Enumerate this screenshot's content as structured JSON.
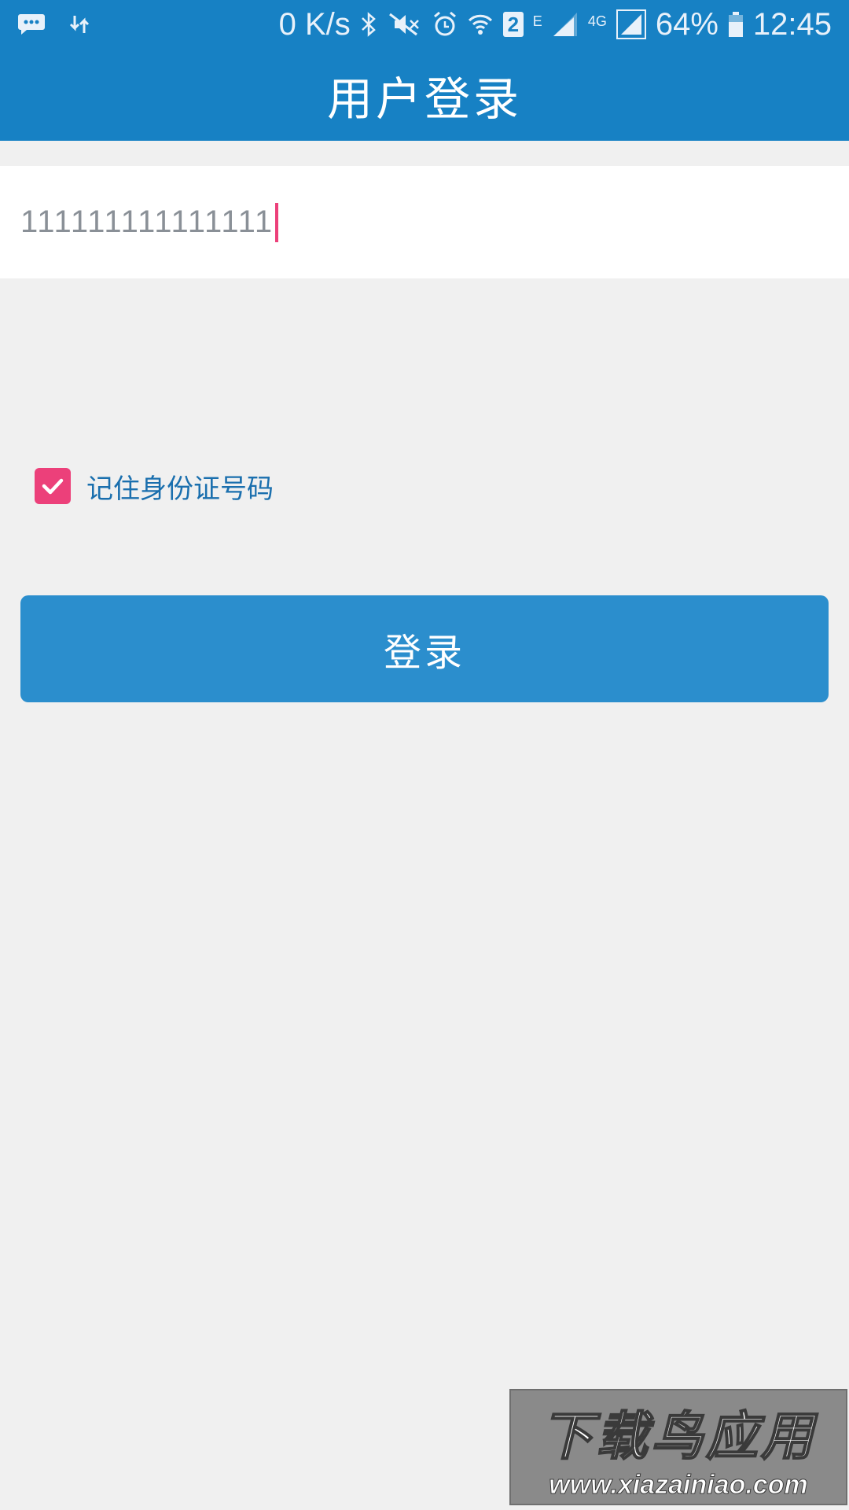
{
  "status_bar": {
    "net_speed": "0 K/s",
    "sim_badge": "2",
    "network_e": "E",
    "network_4g": "4G",
    "battery": "64%",
    "time": "12:45",
    "icons": [
      "chat-icon",
      "data-transfer-icon",
      "bluetooth-icon",
      "mute-icon",
      "alarm-icon",
      "wifi-icon",
      "sim-icon",
      "signal-icon",
      "signal-icon",
      "battery-icon"
    ]
  },
  "app_bar": {
    "title": "用户登录"
  },
  "form": {
    "id_value": "111111111111111",
    "remember_label": "记住身份证号码",
    "remember_checked": true,
    "login_label": "登录"
  },
  "watermark": {
    "title": "下载鸟应用",
    "url": "www.xiazainiao.com"
  },
  "colors": {
    "primary": "#1781c4",
    "button": "#2b8ecd",
    "accent": "#ec407a",
    "background": "#f0f0f0"
  }
}
